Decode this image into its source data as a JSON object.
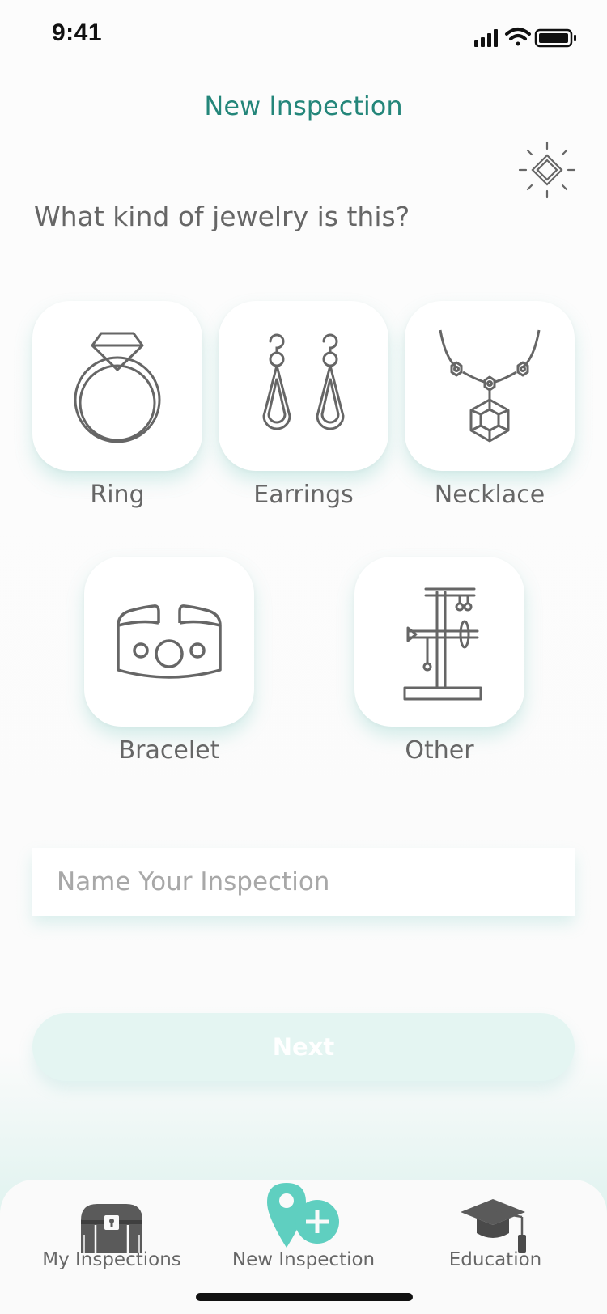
{
  "status_bar": {
    "time": "9:41"
  },
  "header": {
    "title": "New Inspection"
  },
  "question": "What kind of jewelry is this?",
  "categories": [
    {
      "label": "Ring",
      "icon": "ring-icon"
    },
    {
      "label": "Earrings",
      "icon": "earrings-icon"
    },
    {
      "label": "Necklace",
      "icon": "necklace-icon"
    },
    {
      "label": "Bracelet",
      "icon": "bracelet-icon"
    },
    {
      "label": "Other",
      "icon": "jewelry-stand-icon"
    }
  ],
  "name_input": {
    "placeholder": "Name Your Inspection",
    "value": ""
  },
  "next_button": {
    "label": "Next"
  },
  "tabbar": {
    "items": [
      {
        "label": "My Inspections",
        "icon": "treasure-chest-icon"
      },
      {
        "label": "New Inspection",
        "icon": "new-inspection-pin-icon"
      },
      {
        "label": "Education",
        "icon": "graduation-cap-icon"
      }
    ]
  },
  "colors": {
    "accent": "#24867a",
    "tile_shadow": "#6ec8c0",
    "button_disabled": "#e4f5f2",
    "icon_stroke": "#666666",
    "tab_accent": "#5fcfc0"
  }
}
